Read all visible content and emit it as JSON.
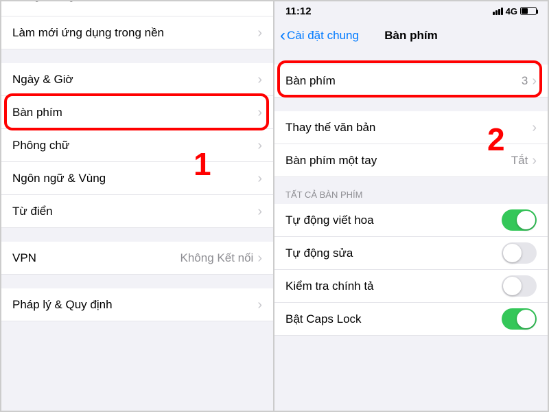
{
  "left": {
    "partial_top": "Dung lượng iPhone",
    "rows_g1": [
      {
        "label": "Làm mới ứng dụng trong nền",
        "detail": "",
        "chevron": true
      }
    ],
    "rows_g2": [
      {
        "label": "Ngày & Giờ",
        "detail": "",
        "chevron": true
      },
      {
        "label": "Bàn phím",
        "detail": "",
        "chevron": true,
        "hl": true
      },
      {
        "label": "Phông chữ",
        "detail": "",
        "chevron": true
      },
      {
        "label": "Ngôn ngữ & Vùng",
        "detail": "",
        "chevron": true
      },
      {
        "label": "Từ điển",
        "detail": "",
        "chevron": true
      }
    ],
    "rows_g3": [
      {
        "label": "VPN",
        "detail": "Không Kết nối",
        "chevron": true
      }
    ],
    "rows_g4": [
      {
        "label": "Pháp lý & Quy định",
        "detail": "",
        "chevron": true
      }
    ],
    "callout": "1"
  },
  "right": {
    "status_time": "11:12",
    "status_net": "4G",
    "nav_back": "Cài đặt chung",
    "nav_title": "Bàn phím",
    "rows_g1": [
      {
        "label": "Bàn phím",
        "detail": "3",
        "chevron": true,
        "hl": true
      }
    ],
    "rows_g2": [
      {
        "label": "Thay thế văn bản",
        "detail": "",
        "chevron": true
      },
      {
        "label": "Bàn phím một tay",
        "detail": "Tắt",
        "chevron": true
      }
    ],
    "group_header": "Tất cả bàn phím",
    "rows_g3": [
      {
        "label": "Tự động viết hoa",
        "toggle": "on"
      },
      {
        "label": "Tự động sửa",
        "toggle": "off"
      },
      {
        "label": "Kiểm tra chính tả",
        "toggle": "off"
      },
      {
        "label": "Bật Caps Lock",
        "toggle": "on"
      }
    ],
    "callout": "2"
  }
}
